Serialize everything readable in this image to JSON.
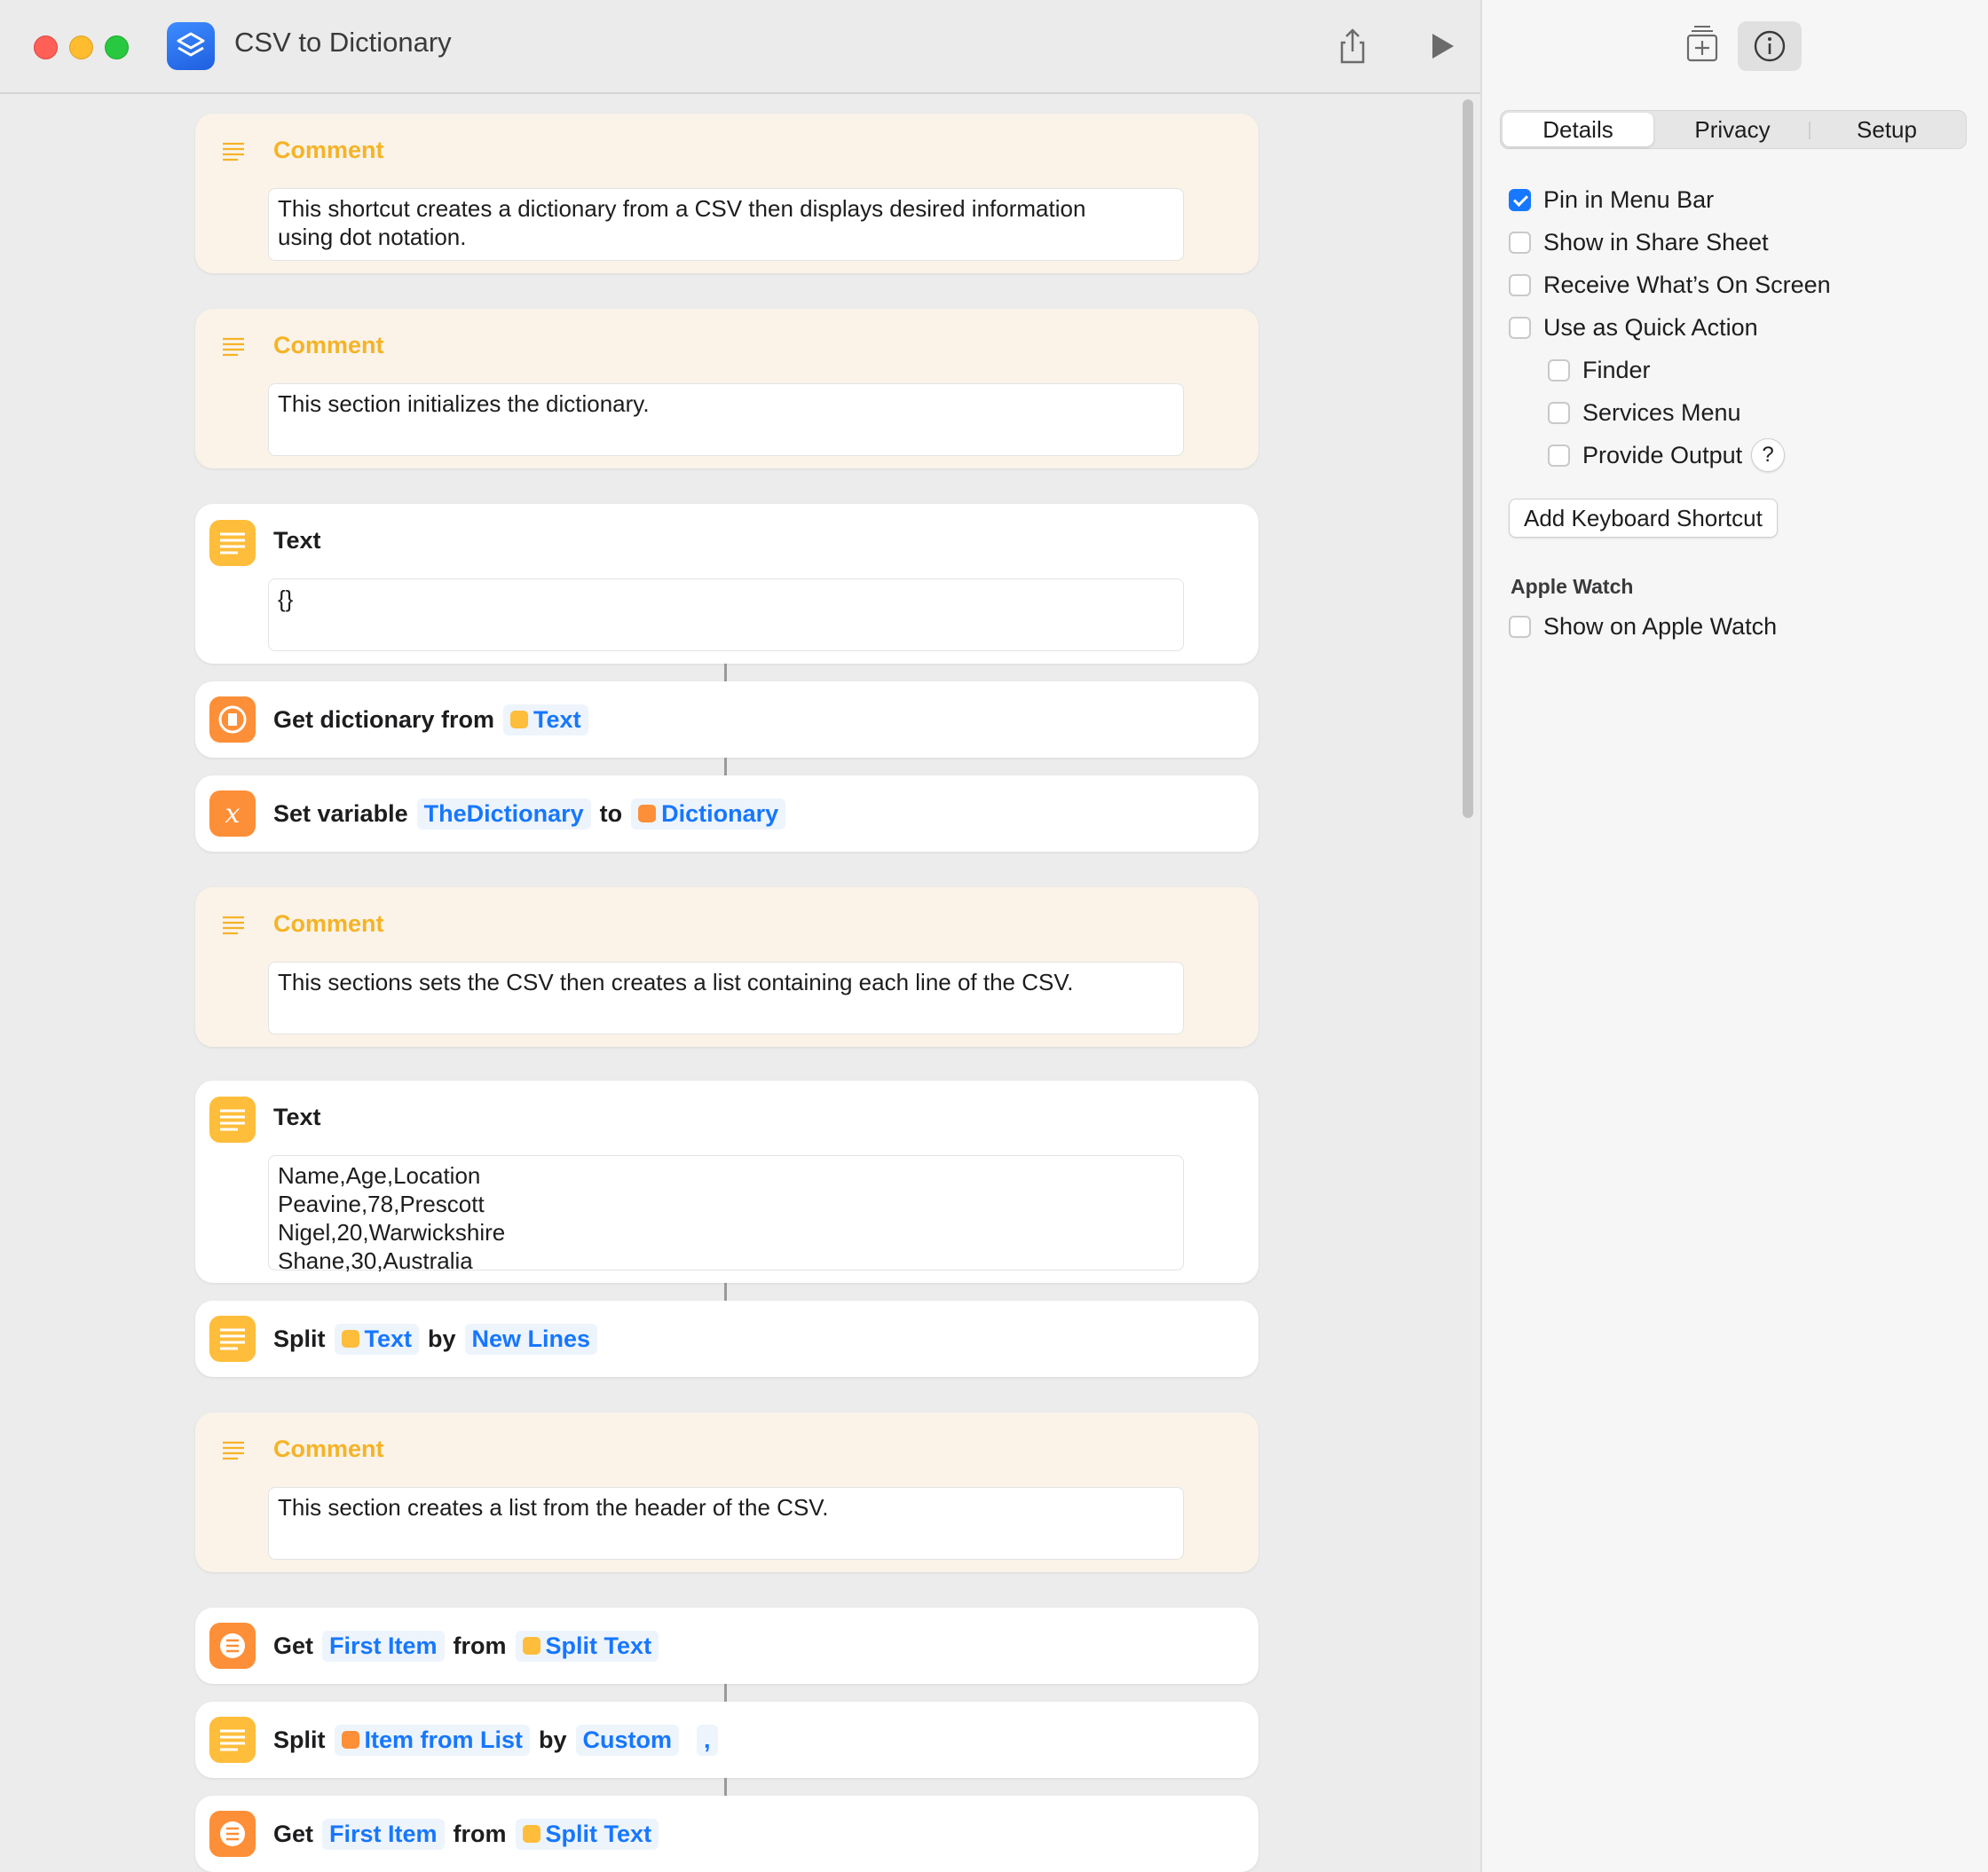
{
  "window": {
    "title": "CSV to Dictionary"
  },
  "inspector": {
    "tabs": [
      "Details",
      "Privacy",
      "Setup"
    ],
    "options": [
      {
        "label": "Pin in Menu Bar",
        "checked": true
      },
      {
        "label": "Show in Share Sheet",
        "checked": false
      },
      {
        "label": "Receive What’s On Screen",
        "checked": false
      },
      {
        "label": "Use as Quick Action",
        "checked": false
      },
      {
        "label": "Finder",
        "checked": false
      },
      {
        "label": "Services Menu",
        "checked": false
      },
      {
        "label": "Provide Output",
        "checked": false
      }
    ],
    "help_glyph": "?",
    "keyboard_button": "Add Keyboard Shortcut",
    "apple_watch": {
      "heading": "Apple Watch",
      "option": "Show on Apple Watch",
      "checked": false
    }
  },
  "actions": {
    "comment1": {
      "title": "Comment",
      "text": "This shortcut creates a dictionary from a CSV then displays desired information\nusing dot notation."
    },
    "comment2": {
      "title": "Comment",
      "text": "This section initializes the dictionary."
    },
    "text1": {
      "title": "Text",
      "text": "{}"
    },
    "getdict": {
      "label": "Get dictionary from",
      "token": "Text"
    },
    "setvar": {
      "label": "Set variable",
      "var": "TheDictionary",
      "to": "to",
      "value": "Dictionary"
    },
    "comment3": {
      "title": "Comment",
      "text": "This sections sets the CSV then creates a list containing each line of the CSV."
    },
    "text2": {
      "title": "Text",
      "text": "Name,Age,Location\nPeavine,78,Prescott\nNigel,20,Warwickshire\nShane,30,Australia"
    },
    "split1": {
      "label": "Split",
      "token": "Text",
      "by": "by",
      "sep": "New Lines"
    },
    "comment4": {
      "title": "Comment",
      "text": "This section creates a list from the header of the CSV."
    },
    "get1": {
      "label": "Get",
      "item": "First Item",
      "from": "from",
      "source": "Split Text"
    },
    "split2": {
      "label": "Split",
      "token": "Item from List",
      "by": "by",
      "sep": "Custom",
      "custom": ","
    },
    "get2": {
      "label": "Get",
      "item": "First Item",
      "from": "from",
      "source": "Split Text"
    }
  }
}
